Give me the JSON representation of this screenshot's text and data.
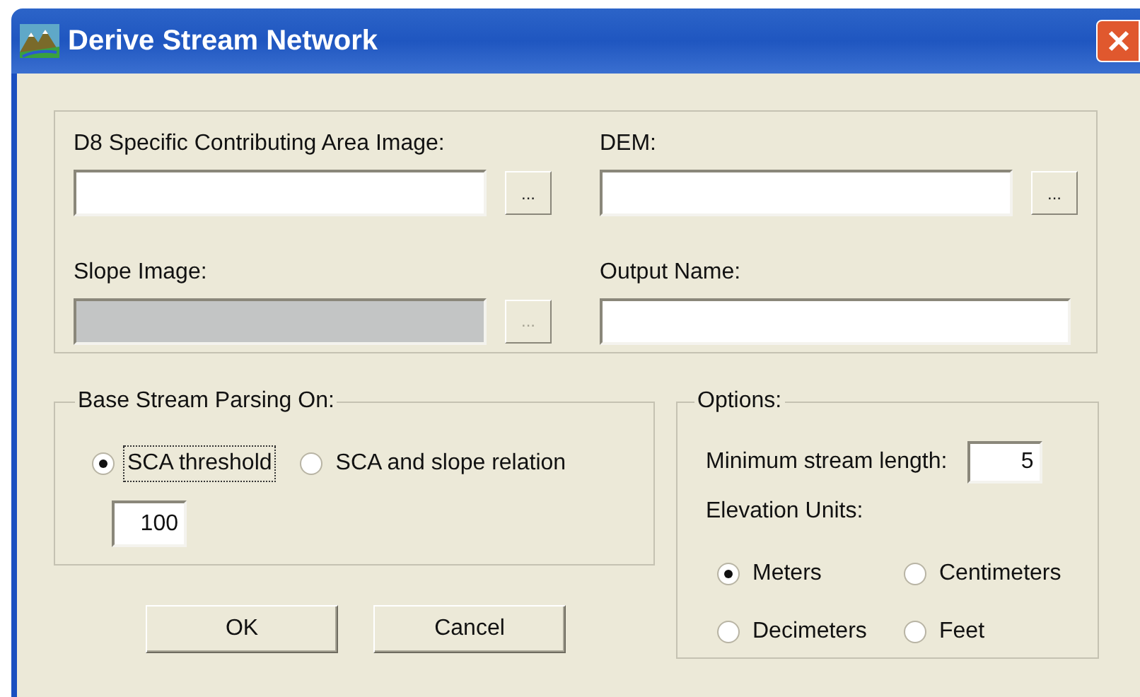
{
  "window": {
    "title": "Derive Stream Network"
  },
  "inputs": [
    {
      "kind": "file",
      "label": "D8 Specific Contributing Area Image:",
      "disabled": false,
      "browse": "..."
    },
    {
      "kind": "file",
      "label": "DEM:",
      "disabled": false,
      "browse": "..."
    },
    {
      "kind": "file",
      "label": "Slope Image:",
      "disabled": true,
      "browse": "..."
    },
    {
      "kind": "text",
      "label": "Output Name:",
      "disabled": false
    }
  ],
  "parsing": {
    "title": "Base Stream Parsing On:",
    "options": [
      {
        "label": "SCA threshold",
        "selected": true,
        "focused": true
      },
      {
        "label": "SCA and slope relation",
        "selected": false,
        "focused": false
      }
    ],
    "threshold": "100"
  },
  "options": {
    "title": "Options:",
    "min_length_label": "Minimum stream length:",
    "min_length": "5",
    "units_label": "Elevation Units:",
    "units": [
      {
        "label": "Meters",
        "selected": true
      },
      {
        "label": "Centimeters",
        "selected": false
      },
      {
        "label": "Decimeters",
        "selected": false
      },
      {
        "label": "Feet",
        "selected": false
      }
    ]
  },
  "buttons": [
    "OK",
    "Cancel"
  ]
}
